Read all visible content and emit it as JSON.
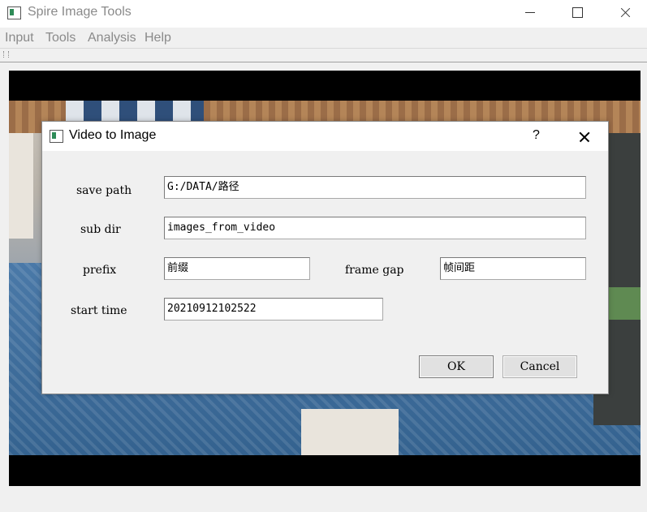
{
  "window": {
    "title": "Spire Image Tools"
  },
  "menu": {
    "items": [
      "Input",
      "Tools",
      "Analysis",
      "Help"
    ]
  },
  "dialog": {
    "title": "Video to Image",
    "help_label": "?",
    "fields": {
      "save_path": {
        "label": "save path",
        "value": "G:/DATA/路径"
      },
      "sub_dir": {
        "label": "sub dir",
        "value": "images_from_video"
      },
      "prefix": {
        "label": "prefix",
        "value": "前缀"
      },
      "frame_gap": {
        "label": "frame gap",
        "value": "帧间距"
      },
      "start_time": {
        "label": "start time",
        "value": "20210912102522"
      }
    },
    "buttons": {
      "ok": "OK",
      "cancel": "Cancel"
    }
  }
}
